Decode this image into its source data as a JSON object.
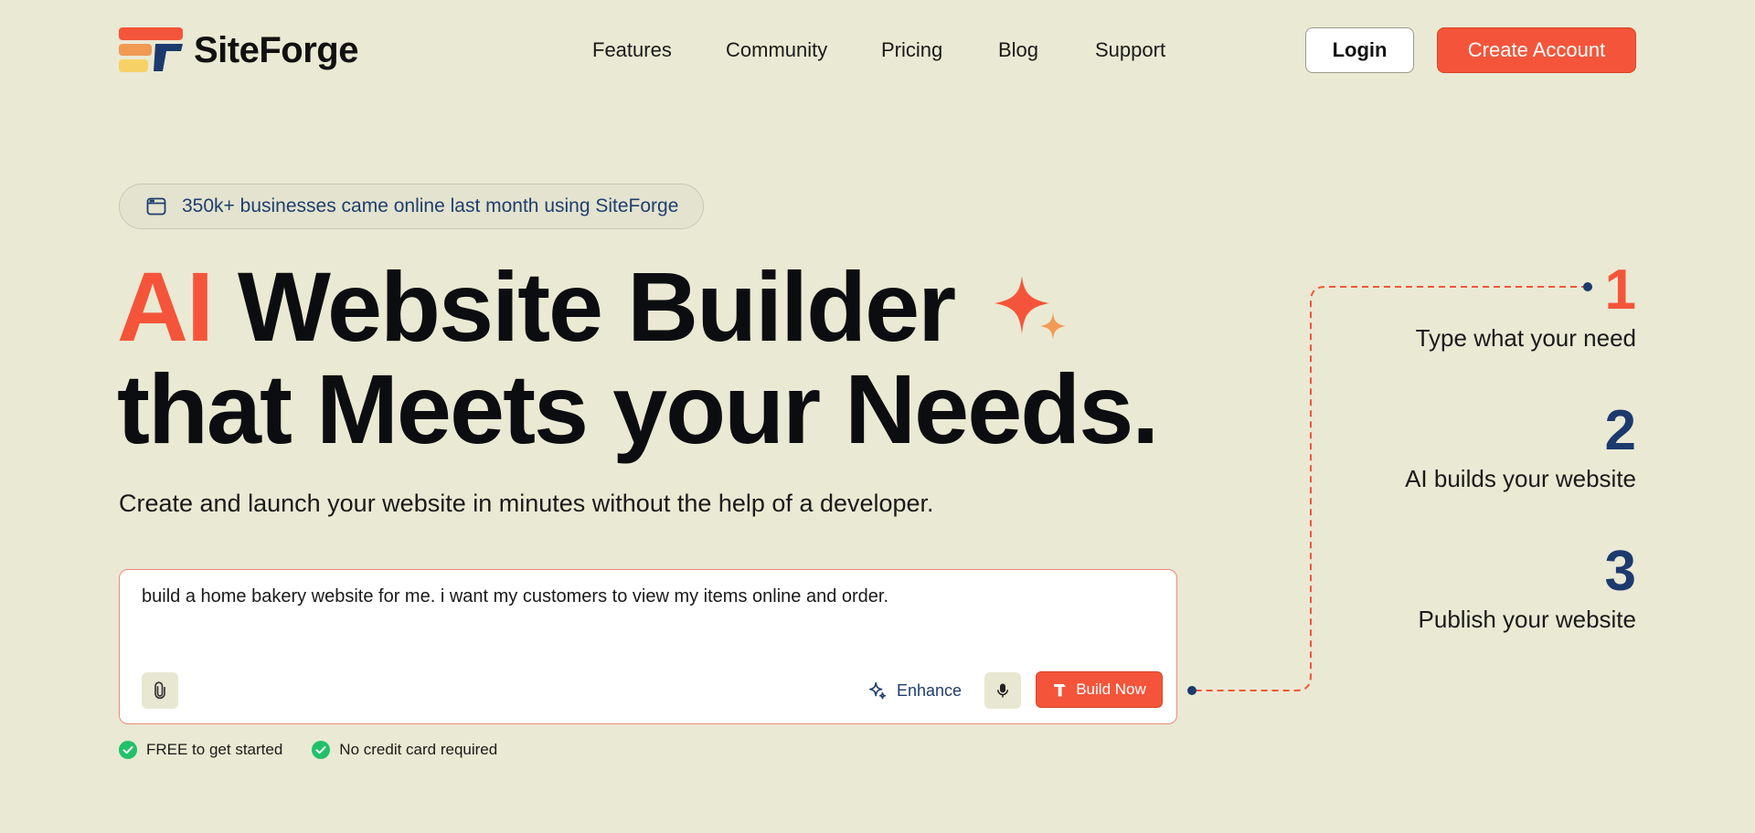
{
  "nav": {
    "brand": "SiteForge",
    "links": [
      "Features",
      "Community",
      "Pricing",
      "Blog",
      "Support"
    ],
    "login_label": "Login",
    "create_account_label": "Create Account"
  },
  "badge": {
    "icon": "browser-window-icon",
    "text": "350k+ businesses came online last month using SiteForge"
  },
  "hero": {
    "headline_accent": "AI",
    "headline_line1_rest": " Website Builder",
    "headline_line2": "that Meets your Needs.",
    "subheadline": "Create and launch your website in minutes without the help of a developer."
  },
  "prompt": {
    "value": "build a home bakery website for me. i want my customers to view my items online and order.",
    "enhance_label": "Enhance",
    "build_label": "Build Now"
  },
  "checks": [
    "FREE to get started",
    "No credit card required"
  ],
  "steps": [
    {
      "number": "1",
      "label": "Type what your need"
    },
    {
      "number": "2",
      "label": "AI builds your website"
    },
    {
      "number": "3",
      "label": "Publish your website"
    }
  ],
  "colors": {
    "background": "#eae9d3",
    "accent": "#f4553a",
    "navy": "#1c3a6e",
    "check_green": "#22c06a"
  }
}
